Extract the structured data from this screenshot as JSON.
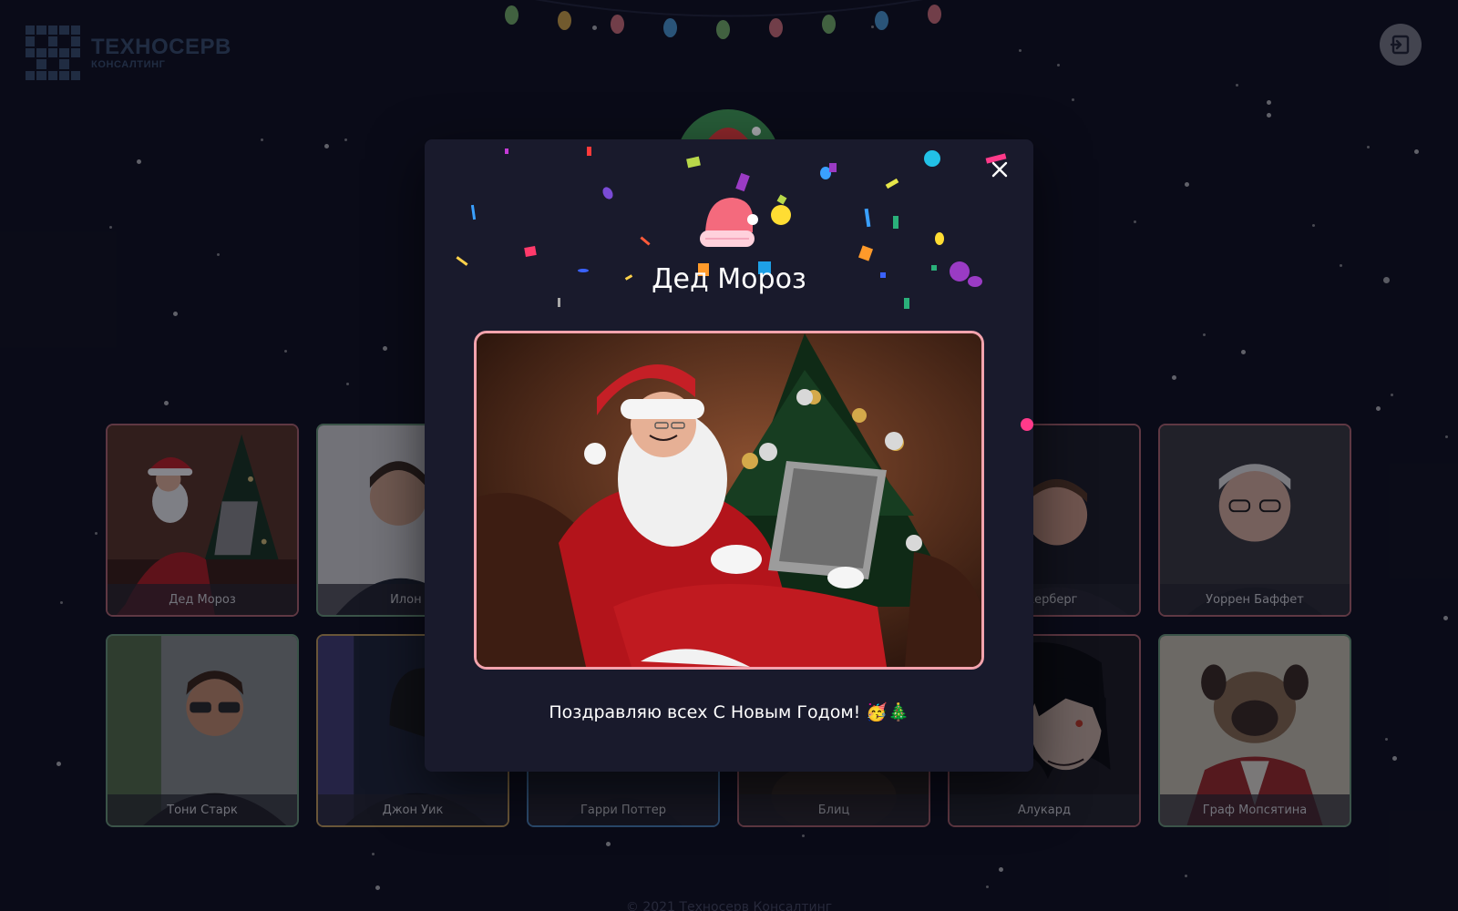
{
  "brand": {
    "title": "ТЕХНОСЕРВ",
    "subtitle": "КОНСАЛТИНГ"
  },
  "header": {
    "logout_icon": "logout-icon"
  },
  "garland_colors": [
    "#7fbf6f",
    "#e0b24a",
    "#e07880",
    "#4fa6e0",
    "#7fbf6f",
    "#e07880",
    "#7fbf6f",
    "#4fa6e0",
    "#e07880"
  ],
  "profiles": [
    {
      "name": "Дед Мороз",
      "border": "pink"
    },
    {
      "name": "Илон М",
      "border": "green"
    },
    {
      "name": "",
      "border": "pink"
    },
    {
      "name": "",
      "border": "pink"
    },
    {
      "name": "Цукерберг",
      "border": "pink"
    },
    {
      "name": "Уоррен Баффет",
      "border": "pink"
    },
    {
      "name": "Тони Старк",
      "border": "green"
    },
    {
      "name": "Джон Уик",
      "border": "gold"
    },
    {
      "name": "Гарри Поттер",
      "border": "blue"
    },
    {
      "name": "Блиц",
      "border": "pink"
    },
    {
      "name": "Алукард",
      "border": "pink"
    },
    {
      "name": "Граф Мопсятина",
      "border": "green"
    }
  ],
  "modal": {
    "title": "Дед Мороз",
    "message": "Поздравляю всех С Новым Годом! 🥳🎄",
    "close_icon": "close-icon",
    "hat_icon": "santa-hat-icon",
    "frame_color": "#f3a3ad"
  },
  "footer": {
    "copyright": "© 2021 Техносерв Консалтинг"
  }
}
